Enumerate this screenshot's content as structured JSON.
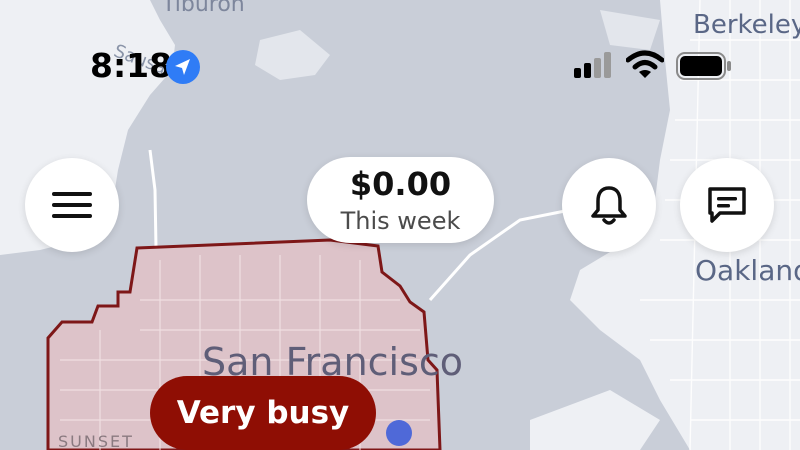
{
  "status_bar": {
    "time": "8:18",
    "location_icon": "location-arrow-icon",
    "signal_icon": "cellular-signal-icon",
    "wifi_icon": "wifi-icon",
    "battery_icon": "battery-icon"
  },
  "map": {
    "labels": {
      "tiburon": "Tiburon",
      "berkeley": "Berkeley",
      "oakland": "Oakland",
      "san_francisco": "San Francisco",
      "sunset": "SUNSET",
      "sausalito": "Sausalito"
    },
    "colors": {
      "water": "#c9ced8",
      "land": "#eef0f4",
      "busy_zone_fill": "#dfc3c9",
      "busy_zone_border": "#7a0e0e",
      "user_location": "#4f69d8"
    }
  },
  "controls": {
    "menu_icon": "hamburger-menu-icon",
    "notifications_icon": "bell-icon",
    "messages_icon": "chat-bubble-icon"
  },
  "earnings": {
    "amount": "$0.00",
    "period": "This week"
  },
  "demand": {
    "label": "Very busy",
    "color": "#8f0e04"
  }
}
